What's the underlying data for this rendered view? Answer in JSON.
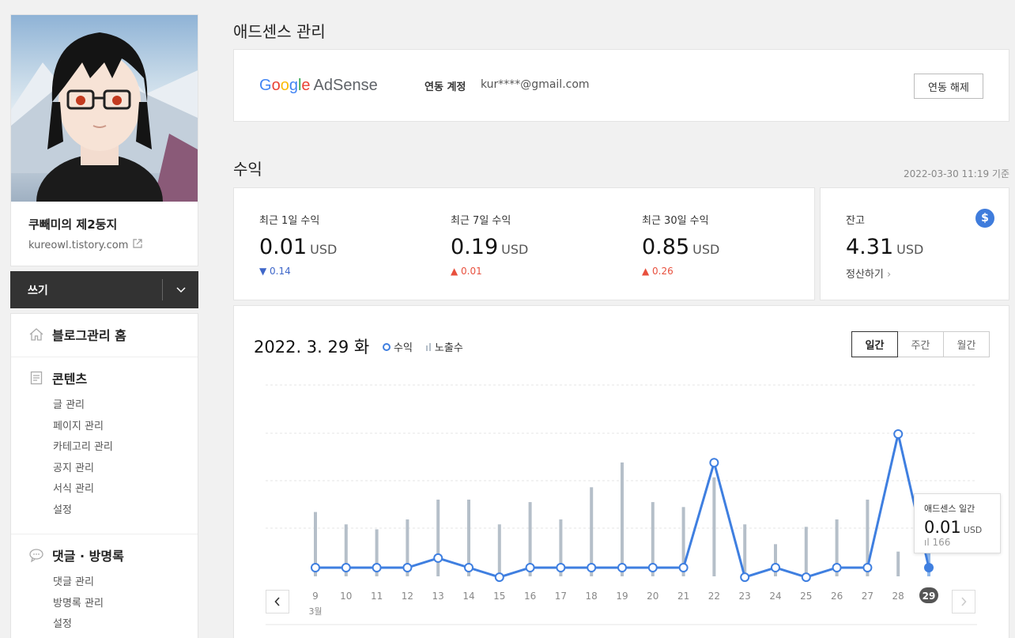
{
  "profile": {
    "blog_name": "쿠빼미의 제2둥지",
    "blog_url": "kureowl.tistory.com"
  },
  "write": {
    "label": "쓰기"
  },
  "menu": {
    "home": "블로그관리 홈",
    "content": {
      "title": "콘텐츠",
      "items": [
        "글 관리",
        "페이지 관리",
        "카테고리 관리",
        "공지 관리",
        "서식 관리",
        "설정"
      ]
    },
    "comments": {
      "title": "댓글 · 방명록",
      "items": [
        "댓글 관리",
        "방명록 관리",
        "설정"
      ]
    }
  },
  "page_title": "애드센스 관리",
  "adsense": {
    "logo_google": [
      "G",
      "o",
      "o",
      "g",
      "l",
      "e"
    ],
    "logo_adsense": "AdSense",
    "link_label": "연동 계정",
    "email": "kur****@gmail.com",
    "unlink_button": "연동 해제"
  },
  "revenue": {
    "title": "수익",
    "as_of": "2022-03-30 11:19 기준",
    "stats": [
      {
        "label": "최근 1일 수익",
        "value": "0.01",
        "unit": "USD",
        "delta": "▼ 0.14",
        "direction": "down"
      },
      {
        "label": "최근 7일 수익",
        "value": "0.19",
        "unit": "USD",
        "delta": "▲ 0.01",
        "direction": "up"
      },
      {
        "label": "최근 30일 수익",
        "value": "0.85",
        "unit": "USD",
        "delta": "▲ 0.26",
        "direction": "up"
      }
    ],
    "balance": {
      "label": "잔고",
      "value": "4.31",
      "unit": "USD",
      "action": "정산하기"
    }
  },
  "chart": {
    "date_title": "2022. 3. 29 화",
    "legend_revenue": "수익",
    "legend_impressions": "노출수",
    "periods": [
      "일간",
      "주간",
      "월간"
    ],
    "active_period": "일간",
    "month_label": "3월",
    "tooltip": {
      "title": "애드센스 일간",
      "value": "0.01",
      "unit": "USD",
      "impressions": "166"
    }
  },
  "chart_data": {
    "type": "line",
    "categories": [
      "9",
      "10",
      "11",
      "12",
      "13",
      "14",
      "15",
      "16",
      "17",
      "18",
      "19",
      "20",
      "21",
      "22",
      "23",
      "24",
      "25",
      "26",
      "27",
      "28",
      "29"
    ],
    "series": [
      {
        "name": "수익",
        "values": [
          0.01,
          0.01,
          0.01,
          0.01,
          0.03,
          0.01,
          -0.01,
          0.01,
          0.01,
          0.01,
          0.01,
          0.01,
          0.01,
          0.23,
          -0.01,
          0.01,
          -0.01,
          0.01,
          0.01,
          0.29,
          0.01
        ]
      },
      {
        "name": "노출수",
        "values": [
          130,
          105,
          95,
          115,
          155,
          155,
          105,
          150,
          115,
          180,
          230,
          150,
          140,
          200,
          105,
          65,
          100,
          115,
          155,
          50,
          166
        ]
      }
    ],
    "highlight_index": 20,
    "colors": {
      "revenue": "#3f7fe0",
      "impressions": "#b5bfc9"
    }
  },
  "icons": {
    "external": "external-link-icon",
    "home": "home-icon",
    "content": "document-icon",
    "comments": "speech-bubble-icon",
    "dollar": "dollar-icon"
  }
}
